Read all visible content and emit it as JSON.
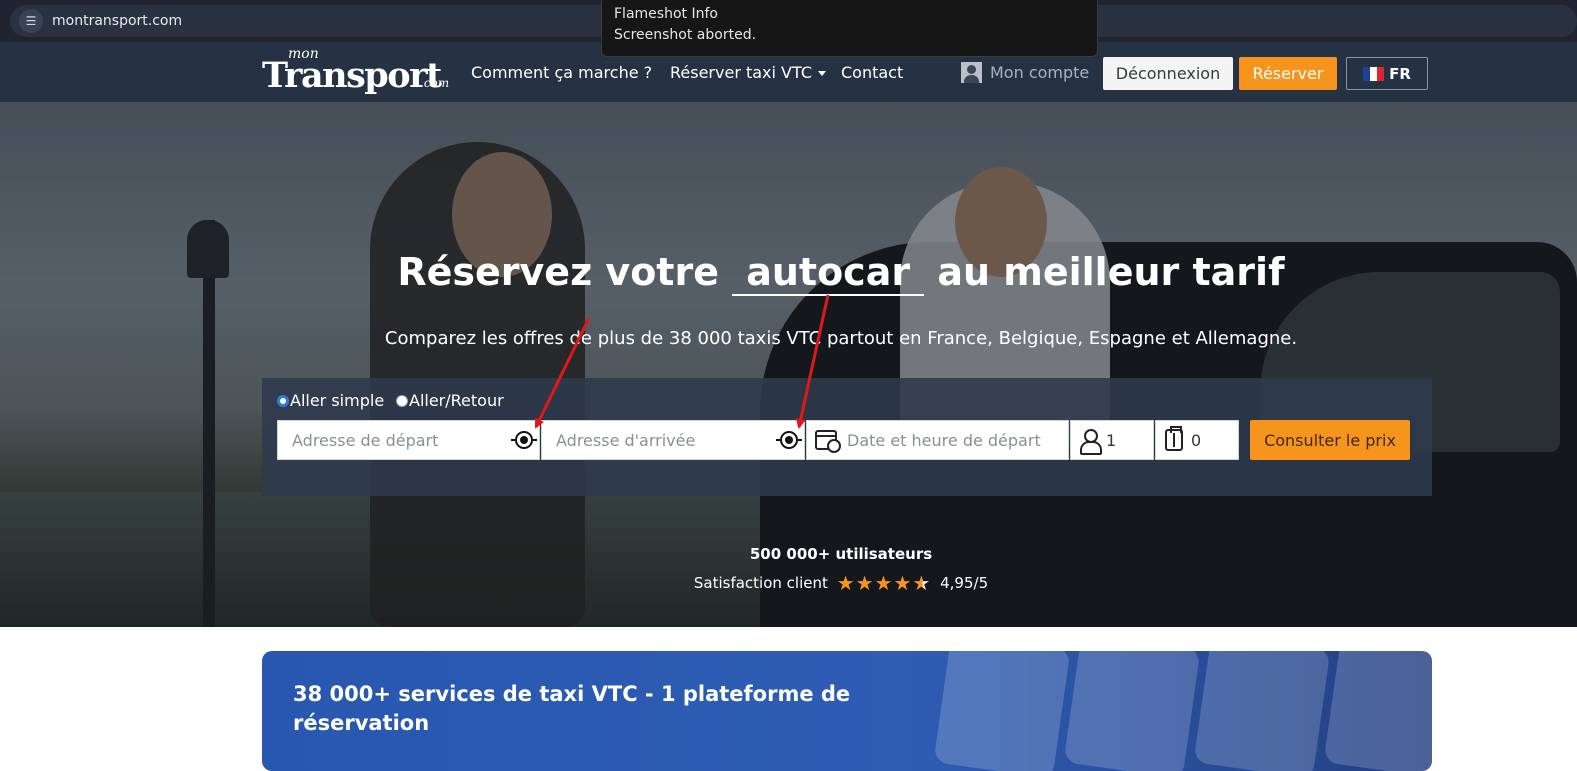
{
  "browser": {
    "url": "montransport.com",
    "site_info_icon": "tune-icon"
  },
  "toast": {
    "title": "Flameshot Info",
    "message": "Screenshot aborted."
  },
  "navbar": {
    "logo": {
      "mon": "mon",
      "transport": "Transport",
      "com": ".com"
    },
    "links": {
      "how": "Comment ça marche ?",
      "book": "Réserver taxi VTC",
      "contact": "Contact"
    },
    "account": "Mon compte",
    "logout": "Déconnexion",
    "reserve": "Réserver",
    "lang": "FR"
  },
  "hero": {
    "title_before": "Réservez votre",
    "title_word": "autocar",
    "title_after": "au meilleur tarif",
    "subtitle": "Comparez les offres de plus de 38 000 taxis VTC partout en France, Belgique, Espagne et Allemagne."
  },
  "search": {
    "trip_simple": "Aller simple",
    "trip_return": "Aller/Retour",
    "selected_trip": "Aller simple",
    "departure_placeholder": "Adresse de départ",
    "arrival_placeholder": "Adresse d'arrivée",
    "date_placeholder": "Date et heure de départ",
    "passengers": "1",
    "luggage": "0",
    "submit": "Consulter le prix"
  },
  "stats": {
    "users": "500 000+ utilisateurs",
    "satisfaction_label": "Satisfaction client",
    "rating": "4,95/5",
    "rating_value": 4.95,
    "rating_max": 5
  },
  "card": {
    "title": "38 000+ services de taxi VTC - 1 plateforme de réservation"
  },
  "colors": {
    "accent": "#f7941d",
    "navbar": "#243244",
    "annotation": "#e01818",
    "card": "#2757b0"
  }
}
